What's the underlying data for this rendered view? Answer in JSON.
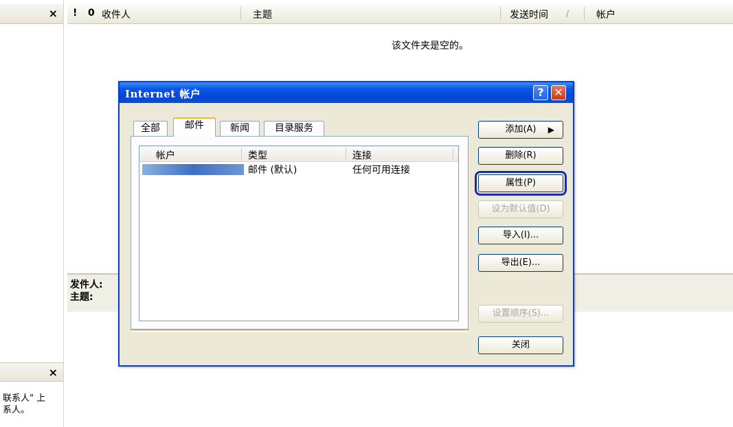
{
  "left_pane": {
    "close_symbol": "×",
    "contacts_close_symbol": "×",
    "contacts_hint_line1": "联系人\" 上",
    "contacts_hint_line2": "系人。"
  },
  "message_list": {
    "columns": {
      "priority": "!",
      "attachment": "0",
      "recipient": "收件人",
      "subject": "主题",
      "sent_time": "发送时间",
      "account": "帐户"
    },
    "empty_text": "该文件夹是空的。"
  },
  "preview": {
    "from_label": "发件人:",
    "subject_label": "主题:"
  },
  "dialog": {
    "title": "Internet 帐户",
    "help_symbol": "?",
    "close_symbol": "✕",
    "tabs": [
      {
        "label": "全部",
        "active": false
      },
      {
        "label": "邮件",
        "active": true
      },
      {
        "label": "新闻",
        "active": false
      },
      {
        "label": "目录服务",
        "active": false
      }
    ],
    "table": {
      "headers": [
        "帐户",
        "类型",
        "连接"
      ],
      "rows": [
        {
          "account": "",
          "type": "邮件 (默认)",
          "connection": "任何可用连接"
        }
      ]
    },
    "buttons": {
      "add": "添加(A)",
      "remove": "删除(R)",
      "properties": "属性(P)",
      "set_default": "设为默认值(D)",
      "import": "导入(I)...",
      "export": "导出(E)...",
      "set_order": "设置顺序(S)...",
      "close": "关闭"
    }
  }
}
